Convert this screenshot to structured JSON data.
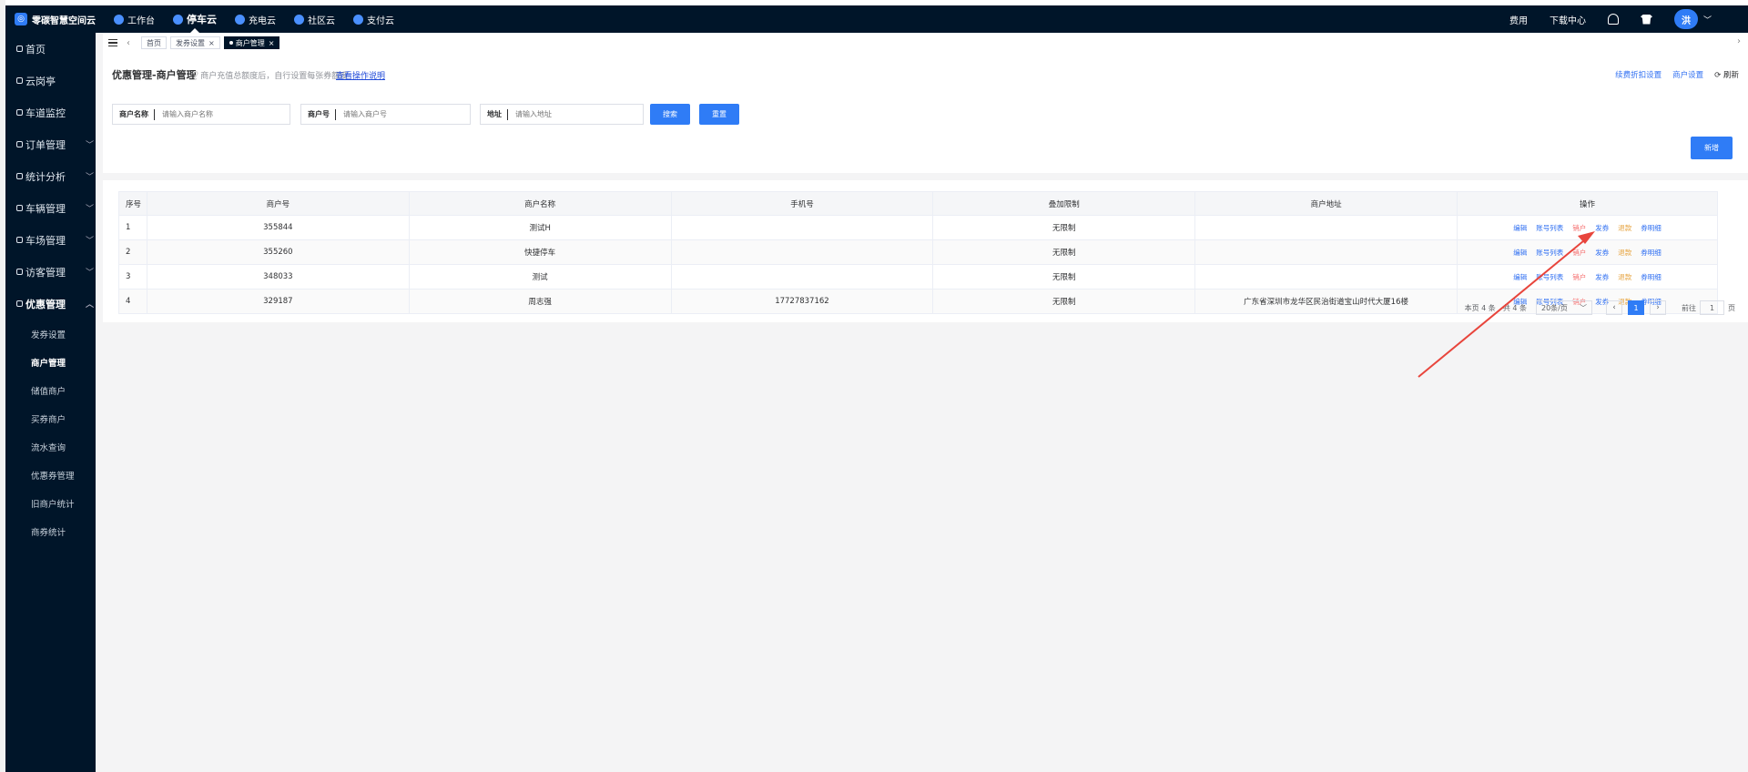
{
  "brand": {
    "name": "零碳智慧空间云"
  },
  "topnav": [
    {
      "label": "工作台"
    },
    {
      "label": "停车云"
    },
    {
      "label": "充电云"
    },
    {
      "label": "社区云"
    },
    {
      "label": "支付云"
    }
  ],
  "topright": {
    "fee": "费用",
    "download": "下载中心",
    "avatar": "洪"
  },
  "sidebar": {
    "items": [
      {
        "label": "首页"
      },
      {
        "label": "云岗亭"
      },
      {
        "label": "车道监控"
      },
      {
        "label": "订单管理"
      },
      {
        "label": "统计分析"
      },
      {
        "label": "车辆管理"
      },
      {
        "label": "车场管理"
      },
      {
        "label": "访客管理"
      },
      {
        "label": "优惠管理"
      }
    ],
    "subitems": [
      {
        "label": "发券设置"
      },
      {
        "label": "商户管理"
      },
      {
        "label": "储值商户"
      },
      {
        "label": "买券商户"
      },
      {
        "label": "流水查询"
      },
      {
        "label": "优惠券管理"
      },
      {
        "label": "旧商户统计"
      },
      {
        "label": "商券统计"
      }
    ]
  },
  "tabs": [
    {
      "label": "首页"
    },
    {
      "label": "发券设置"
    },
    {
      "label": "商户管理"
    }
  ],
  "page": {
    "title": "优惠管理-商户管理",
    "hint": "商户充值总额度后，自行设置每张券额度",
    "link": "查看操作说明",
    "links": {
      "discount": "续费折扣设置",
      "merchant_settings": "商户设置",
      "refresh": "刷新"
    }
  },
  "filters": {
    "name_label": "商户名称",
    "name_placeholder": "请输入商户名称",
    "no_label": "商户号",
    "no_placeholder": "请输入商户号",
    "addr_label": "地址",
    "addr_placeholder": "请输入地址",
    "search": "搜索",
    "reset": "重置",
    "add": "新增"
  },
  "table": {
    "headers": [
      "序号",
      "商户号",
      "商户名称",
      "手机号",
      "叠加限制",
      "商户地址",
      "操作"
    ],
    "ops": {
      "edit": "编辑",
      "accounts": "账号列表",
      "cancel": "销户",
      "issue": "发券",
      "refund": "退款",
      "detail": "券明细"
    },
    "rows": [
      {
        "idx": "1",
        "no": "355844",
        "name": "测试H",
        "phone": "",
        "limit": "无限制",
        "addr": ""
      },
      {
        "idx": "2",
        "no": "355260",
        "name": "快捷停车",
        "phone": "",
        "limit": "无限制",
        "addr": ""
      },
      {
        "idx": "3",
        "no": "348033",
        "name": "测试",
        "phone": "",
        "limit": "无限制",
        "addr": ""
      },
      {
        "idx": "4",
        "no": "329187",
        "name": "周志强",
        "phone": "17727837162",
        "limit": "无限制",
        "addr": "广东省深圳市龙华区民治街道宝山时代大厦16楼"
      }
    ]
  },
  "pager": {
    "page_count": "本页 4 条",
    "total": "共 4 条",
    "size": "20条/页",
    "current": "1",
    "goto": "前往",
    "goto_value": "1",
    "unit": "页"
  },
  "colors": {
    "sidebar_bg": "#001529",
    "primary": "#2f7cf6",
    "danger": "#f56c6c",
    "warning": "#e6a23c",
    "annotation_arrow": "#e8453c"
  }
}
